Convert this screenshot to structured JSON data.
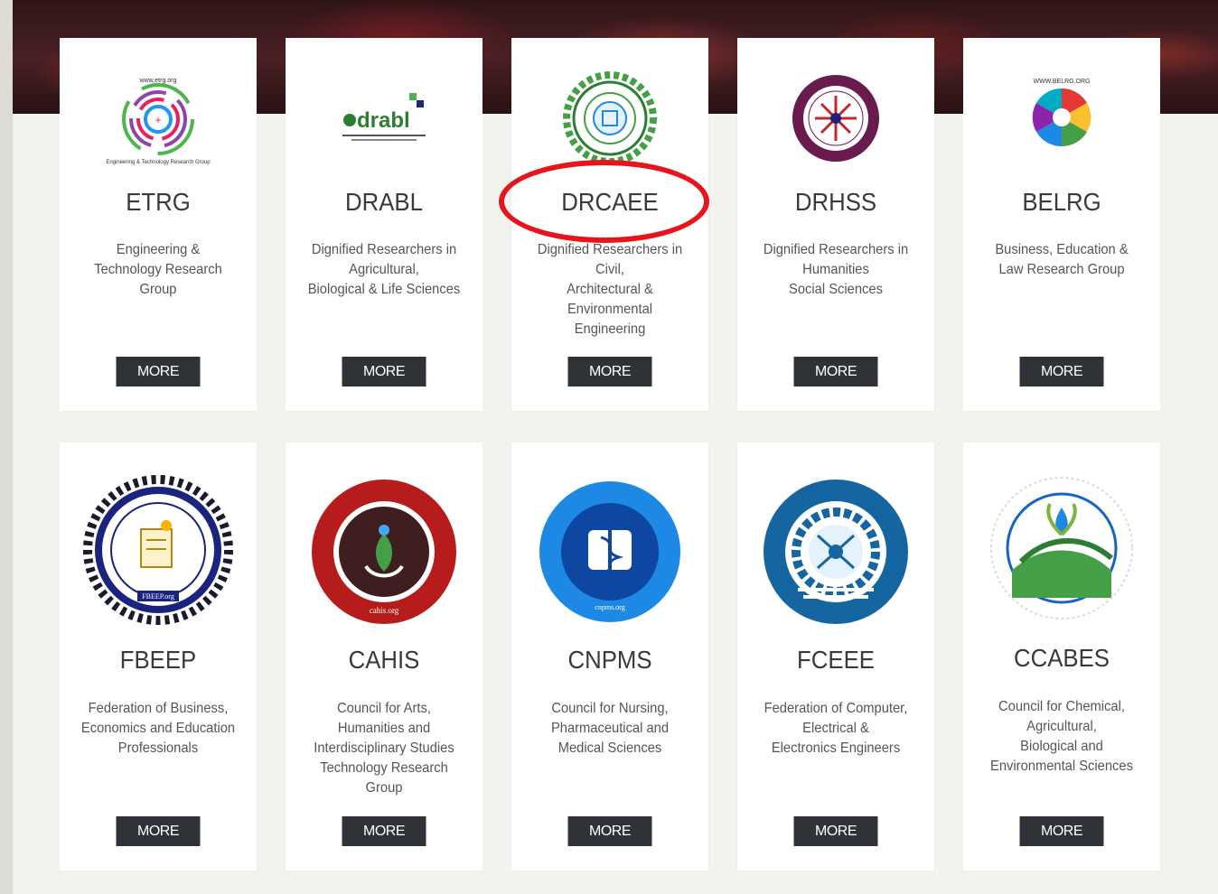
{
  "row1": [
    {
      "abbr": "ETRG",
      "desc": [
        "Engineering &",
        "Technology Research",
        "Group"
      ],
      "button": "MORE",
      "logo_text": "www.etrg.org",
      "logo_caption": "Engineering & Technology Research Group"
    },
    {
      "abbr": "DRABL",
      "desc": [
        "Dignified Researchers in",
        "Agricultural,",
        "Biological & Life Sciences"
      ],
      "button": "MORE",
      "logo_text": "drabl"
    },
    {
      "abbr": "DRCAEE",
      "desc": [
        "Dignified Researchers in",
        "Civil,",
        "Architectural &",
        "Environmental",
        "Engineering"
      ],
      "button": "MORE"
    },
    {
      "abbr": "DRHSS",
      "desc": [
        "Dignified Researchers in",
        "Humanities",
        "Social Sciences"
      ],
      "button": "MORE"
    },
    {
      "abbr": "BELRG",
      "desc": [
        "Business, Education &",
        "Law Research Group"
      ],
      "button": "MORE",
      "logo_text": "WWW.BELRG.ORG"
    }
  ],
  "row2": [
    {
      "abbr": "FBEEP",
      "desc": [
        "Federation of Business,",
        "Economics and Education",
        "Professionals"
      ],
      "button": "MORE",
      "logo_text": "FBEEP.org"
    },
    {
      "abbr": "CAHIS",
      "desc": [
        "Council for Arts,",
        "Humanities and",
        "Interdisciplinary Studies",
        "Technology Research",
        "Group"
      ],
      "button": "MORE",
      "logo_text": "cahis.org"
    },
    {
      "abbr": "CNPMS",
      "desc": [
        "Council for Nursing,",
        "Pharmaceutical and",
        "Medical Sciences"
      ],
      "button": "MORE",
      "logo_text": "cnpms.org"
    },
    {
      "abbr": "FCEEE",
      "desc": [
        "Federation of Computer,",
        "Electrical &",
        "Electronics Engineers"
      ],
      "button": "MORE"
    },
    {
      "abbr": "CCABES",
      "desc": [
        "Council for Chemical,",
        "Agricultural,",
        "Biological and",
        "Environmental Sciences"
      ],
      "button": "MORE"
    }
  ],
  "colors": {
    "button_bg": "#2f3338",
    "highlight": "#e8131b",
    "heading": "#3a3a3a"
  }
}
